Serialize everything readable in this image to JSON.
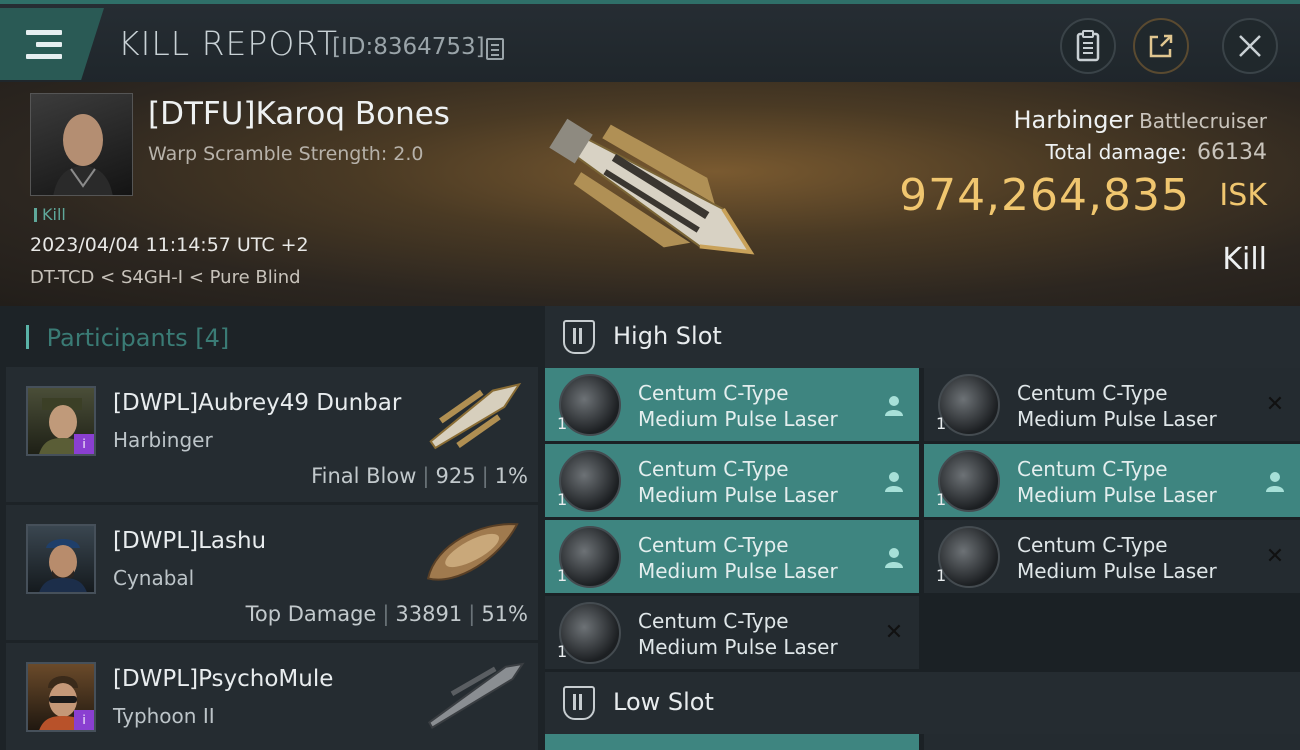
{
  "header": {
    "title": "KILL REPORT",
    "id_label": "[ID:8364753]",
    "icons": [
      "menu-icon",
      "copy-icon",
      "clipboard-icon",
      "share-icon",
      "close-icon"
    ]
  },
  "victim": {
    "name": "[DTFU]Karoq Bones",
    "scram": "Warp Scramble Strength: 2.0",
    "kill_tag": "Kill",
    "datetime": "2023/04/04 11:14:57 UTC +2",
    "location": "DT-TCD < S4GH-I < Pure Blind",
    "ship_name": "Harbinger",
    "ship_class": "Battlecruiser",
    "total_damage_label": "Total damage:",
    "total_damage": "66134",
    "isk_value": "974,264,835",
    "isk_unit": "ISK",
    "result": "Kill"
  },
  "participants": {
    "label": "Participants",
    "count": "[4]",
    "items": [
      {
        "name": "[DWPL]Aubrey49 Dunbar",
        "ship": "Harbinger",
        "role": "Final Blow",
        "damage": "925",
        "percent": "1%"
      },
      {
        "name": "[DWPL]Lashu",
        "ship": "Cynabal",
        "role": "Top Damage",
        "damage": "33891",
        "percent": "51%"
      },
      {
        "name": "[DWPL]PsychoMule",
        "ship": "Typhoon II"
      }
    ]
  },
  "fittings": {
    "high_slot_label": "High Slot",
    "low_slot_label": "Low Slot",
    "high_modules": [
      {
        "name1": "Centum C-Type",
        "name2": "Medium Pulse Laser",
        "qty": "1",
        "status": "pilot"
      },
      {
        "name1": "Centum C-Type",
        "name2": "Medium Pulse Laser",
        "qty": "1",
        "status": "destroyed"
      },
      {
        "name1": "Centum C-Type",
        "name2": "Medium Pulse Laser",
        "qty": "1",
        "status": "pilot"
      },
      {
        "name1": "Centum C-Type",
        "name2": "Medium Pulse Laser",
        "qty": "1",
        "status": "pilot"
      },
      {
        "name1": "Centum C-Type",
        "name2": "Medium Pulse Laser",
        "qty": "1",
        "status": "pilot"
      },
      {
        "name1": "Centum C-Type",
        "name2": "Medium Pulse Laser",
        "qty": "1",
        "status": "destroyed"
      },
      {
        "name1": "Centum C-Type",
        "name2": "Medium Pulse Laser",
        "qty": "1",
        "status": "destroyed"
      }
    ]
  },
  "colors": {
    "accent": "#3e8580",
    "isk_gold": "#f0c66f",
    "panel": "#252c31"
  }
}
